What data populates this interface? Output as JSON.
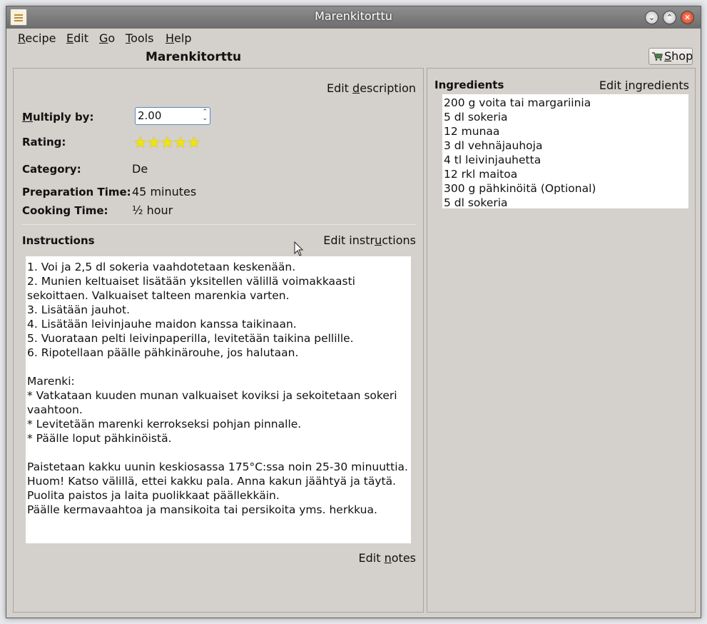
{
  "window": {
    "title": "Marenkitorttu"
  },
  "menu": {
    "items": [
      {
        "pre": "",
        "key": "R",
        "post": "ecipe"
      },
      {
        "pre": "",
        "key": "E",
        "post": "dit"
      },
      {
        "pre": "",
        "key": "G",
        "post": "o"
      },
      {
        "pre": "",
        "key": "T",
        "post": "ools"
      },
      {
        "pre": "",
        "key": "H",
        "post": "elp"
      }
    ]
  },
  "recipe_title": "Marenkitorttu",
  "shop": {
    "pre": "",
    "key": "S",
    "post": "hop"
  },
  "description": {
    "edit_link": {
      "pre": "Edit ",
      "key": "d",
      "post": "escription"
    },
    "multiply_label": {
      "pre": "",
      "key": "M",
      "post": "ultiply by:"
    },
    "multiply_value": "2.00",
    "rating_label": "Rating:",
    "rating": 5,
    "stars": "★★★★★",
    "category_label": "Category:",
    "category_value": "De",
    "prep_label": "Preparation Time:",
    "prep_value": "45 minutes",
    "cook_label": "Cooking Time:",
    "cook_value": "½ hour"
  },
  "instructions": {
    "heading": "Instructions",
    "edit_link": {
      "pre": "Edit instr",
      "key": "u",
      "post": "ctions"
    },
    "lines": [
      "1. Voi ja 2,5 dl sokeria vaahdotetaan keskenään.",
      "2. Munien keltuaiset lisätään yksitellen välillä voimakkaasti",
      "sekoittaen. Valkuaiset talteen marenkia varten.",
      "3. Lisätään jauhot.",
      "4. Lisätään leivinjauhe maidon kanssa taikinaan.",
      "5. Vuorataan pelti leivinpaperilla, levitetään taikina pellille.",
      "6. Ripotellaan päälle pähkinärouhe, jos halutaan.",
      "",
      "Marenki:",
      "* Vatkataan kuuden munan valkuaiset koviksi ja sekoitetaan sokeri",
      "vaahtoon.",
      "* Levitetään marenki kerrokseksi pohjan pinnalle.",
      "* Päälle loput pähkinöistä.",
      "",
      "Paistetaan kakku uunin keskiosassa 175°C:ssa noin 25-30 minuuttia.",
      "Huom! Katso välillä, ettei kakku pala. Anna kakun jäähtyä ja täytä.",
      "Puolita paistos ja laita puolikkaat päällekkäin.",
      "Päälle kermavaahtoa ja mansikoita tai persikoita yms. herkkua."
    ],
    "edit_notes_link": {
      "pre": "Edit ",
      "key": "n",
      "post": "otes"
    }
  },
  "ingredients": {
    "heading": "Ingredients",
    "edit_link": {
      "pre": "Edit ",
      "key": "i",
      "post": "ngredients"
    },
    "items": [
      "200 g voita tai margariinia",
      "5 dl sokeria",
      "12 munaa",
      "3 dl vehnäjauhoja",
      "4 tl leivinjauhetta",
      "12 rkl maitoa",
      "300 g pähkinöitä (Optional)",
      "5 dl sokeria"
    ]
  },
  "colors": {
    "star": "#f1e30f",
    "close_button": "#d23a1b",
    "titlebar": "#7a7a7a"
  }
}
